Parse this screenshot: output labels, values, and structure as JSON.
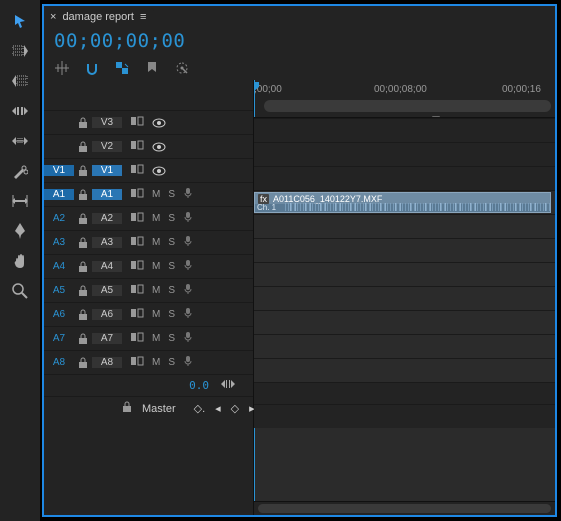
{
  "tab": {
    "close": "×",
    "title": "damage report",
    "menu": "≡"
  },
  "timecode": "00;00;00;00",
  "ruler": {
    "labels": [
      {
        "text": ";00;00",
        "pos": 0
      },
      {
        "text": "00;00;08;00",
        "pos": 120
      },
      {
        "text": "00;00;16",
        "pos": 248
      }
    ]
  },
  "videoTracks": [
    {
      "src": "",
      "name": "V3",
      "eye": true
    },
    {
      "src": "",
      "name": "V2",
      "eye": true
    },
    {
      "src": "V1",
      "name": "V1",
      "eye": true,
      "srcSel": true,
      "selected": true
    }
  ],
  "audioTracks": [
    {
      "src": "A1",
      "name": "A1",
      "srcSel": true,
      "selected": true
    },
    {
      "src": "A2",
      "name": "A2"
    },
    {
      "src": "A3",
      "name": "A3"
    },
    {
      "src": "A4",
      "name": "A4"
    },
    {
      "src": "A5",
      "name": "A5"
    },
    {
      "src": "A6",
      "name": "A6"
    },
    {
      "src": "A7",
      "name": "A7"
    },
    {
      "src": "A8",
      "name": "A8"
    }
  ],
  "toggles": {
    "mute": "M",
    "solo": "S"
  },
  "clip": {
    "fx": "fx",
    "name": "A011C056_140122Y7.MXF",
    "channel": "Ch. 1"
  },
  "footer": {
    "value": "0.0",
    "master": "Master"
  }
}
